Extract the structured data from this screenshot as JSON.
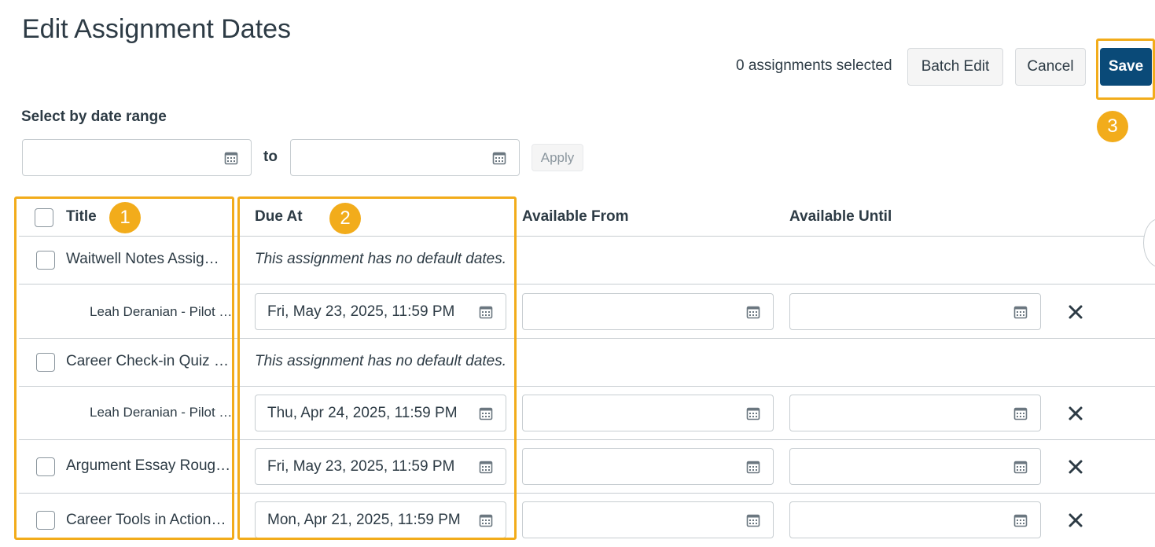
{
  "page": {
    "title": "Edit Assignment Dates"
  },
  "toolbar": {
    "selected_count": "0 assignments selected",
    "batch_edit_label": "Batch Edit",
    "cancel_label": "Cancel",
    "save_label": "Save"
  },
  "date_range": {
    "label": "Select by date range",
    "from_value": "",
    "to_word": "to",
    "to_value": "",
    "apply_label": "Apply"
  },
  "badges": {
    "one": "1",
    "two": "2",
    "three": "3"
  },
  "table": {
    "columns": [
      "Title",
      "Due At",
      "Available From",
      "Available Until"
    ],
    "rows": [
      {
        "kind": "assignment",
        "title": "Waitwell Notes Assig…",
        "note": "This assignment has no default dates."
      },
      {
        "kind": "override",
        "title": "Leah Deranian - Pilot …",
        "due_at": "Fri, May 23, 2025, 11:59 PM",
        "available_from": "",
        "available_until": ""
      },
      {
        "kind": "assignment",
        "title": "Career Check-in Quiz …",
        "note": "This assignment has no default dates."
      },
      {
        "kind": "override",
        "title": "Leah Deranian - Pilot …",
        "due_at": "Thu, Apr 24, 2025, 11:59 PM",
        "available_from": "",
        "available_until": ""
      },
      {
        "kind": "assignment",
        "title": "Argument Essay Roug…",
        "due_at": "Fri, May 23, 2025, 11:59 PM",
        "available_from": "",
        "available_until": ""
      },
      {
        "kind": "assignment",
        "title": "Career Tools in Action…",
        "due_at": "Mon, Apr 21, 2025, 11:59 PM",
        "available_from": "",
        "available_until": ""
      }
    ]
  },
  "icons": {
    "calendar": "calendar-icon",
    "remove": "close-icon"
  },
  "colors": {
    "accent": "#f2ac1b",
    "primary": "#0a4a78"
  }
}
